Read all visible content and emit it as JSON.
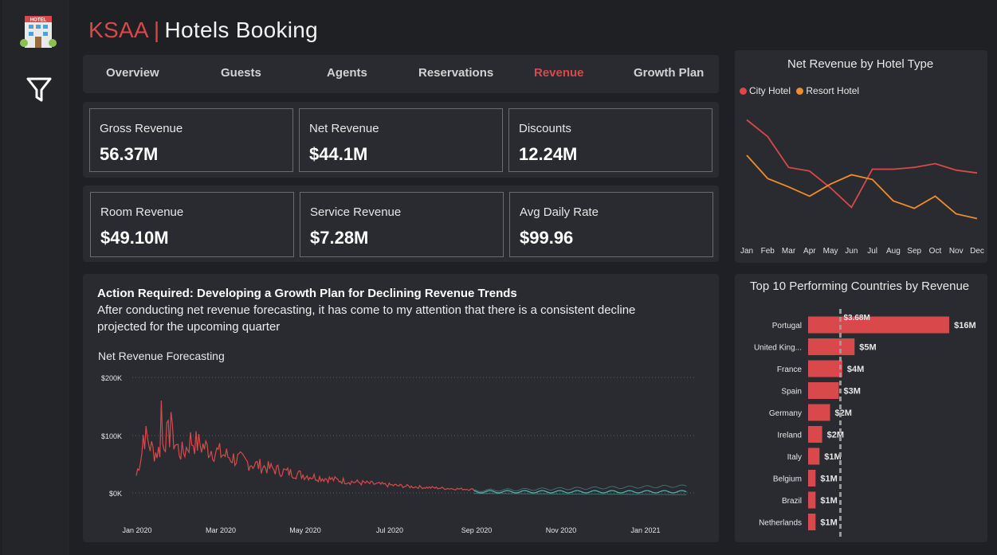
{
  "header": {
    "brand": "KSAA",
    "separator": "|",
    "title": "Hotels Booking"
  },
  "sidebar": {
    "logo_icon": "hotel-icon",
    "logo_text": "HOTEL",
    "filter_icon": "filter-icon"
  },
  "nav": {
    "tabs": [
      {
        "label": "Overview",
        "active": false
      },
      {
        "label": "Guests",
        "active": false
      },
      {
        "label": "Agents",
        "active": false
      },
      {
        "label": "Reservations",
        "active": false
      },
      {
        "label": "Revenue",
        "active": true
      },
      {
        "label": "Growth Plan",
        "active": false
      }
    ]
  },
  "kpis": [
    {
      "label": "Gross Revenue",
      "value": "56.37M"
    },
    {
      "label": "Net Revenue",
      "value": "$44.1M"
    },
    {
      "label": "Discounts",
      "value": "12.24M"
    },
    {
      "label": "Room Revenue",
      "value": "$49.10M"
    },
    {
      "label": "Service Revenue",
      "value": "$7.28M"
    },
    {
      "label": "Avg Daily Rate",
      "value": "$99.96"
    }
  ],
  "action": {
    "title": "Action Required: Developing a Growth Plan for Declining Revenue Trends",
    "body": "After conducting net revenue forecasting, it has come to my attention that there is a consistent decline projected for the upcoming quarter"
  },
  "colors": {
    "city": "#d9484a",
    "resort": "#f08c2b",
    "forecast": "#5fb3b3",
    "accent": "#d9484a"
  },
  "chart_data": [
    {
      "type": "line",
      "title": "Net Revenue by Hotel Type",
      "categories": [
        "Jan",
        "Feb",
        "Mar",
        "Apr",
        "May",
        "Jun",
        "Jul",
        "Aug",
        "Sep",
        "Oct",
        "Nov",
        "Dec"
      ],
      "series": [
        {
          "name": "City Hotel",
          "values": [
            155,
            137,
            104,
            100,
            82,
            61,
            102,
            102,
            104,
            108,
            101,
            98
          ]
        },
        {
          "name": "Resort Hotel",
          "values": [
            117,
            92,
            83,
            73,
            86,
            96,
            91,
            68,
            60,
            73,
            54,
            49
          ]
        }
      ],
      "legend": "top-left",
      "ylim": [
        40,
        170
      ]
    },
    {
      "type": "bar",
      "title": "Top 10 Performing Countries by Revenue",
      "categories": [
        "Portugal",
        "United King...",
        "France",
        "Spain",
        "Germany",
        "Ireland",
        "Italy",
        "Belgium",
        "Brazil",
        "Netherlands"
      ],
      "values": [
        16.1,
        5.3,
        3.9,
        3.5,
        2.5,
        1.6,
        1.3,
        0.85,
        0.85,
        0.85
      ],
      "labels": [
        "$16M",
        "$5M",
        "$4M",
        "$3M",
        "$2M",
        "$2M",
        "$1M",
        "$1M",
        "$1M",
        "$1M"
      ],
      "reference_line": {
        "value": 3.68,
        "label": "$3.68M"
      }
    },
    {
      "type": "line",
      "title": "Net Revenue Forecasting",
      "yticks": [
        "$200K",
        "$100K",
        "$0K"
      ],
      "ylim": [
        0,
        200
      ],
      "xticks": [
        "Jan 2020",
        "Mar 2020",
        "May 2020",
        "Jul 2020",
        "Sep 2020",
        "Nov 2020",
        "Jan 2021"
      ],
      "start_date": "2020-01-01",
      "actual_end_date": "2020-08-31",
      "forecast_end_date": "2021-01-31",
      "grid": true
    }
  ]
}
